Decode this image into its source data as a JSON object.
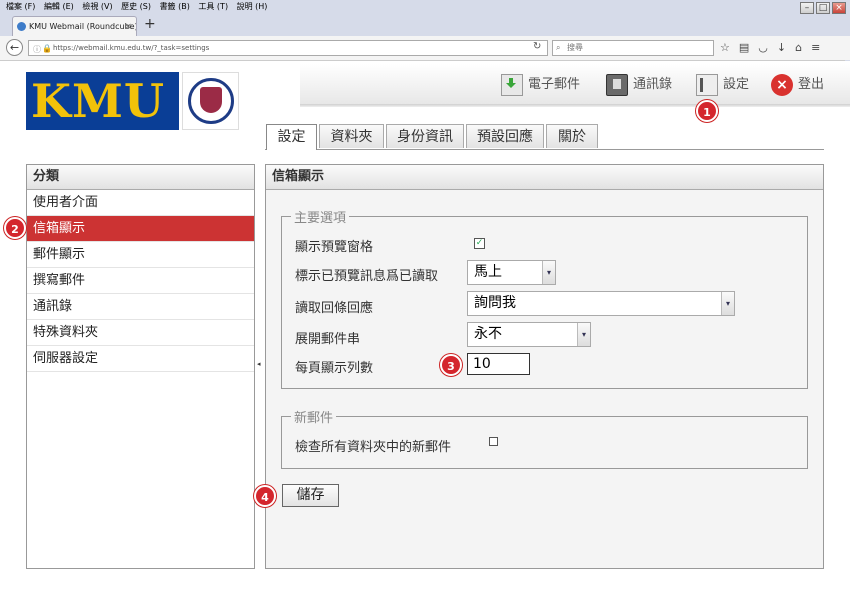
{
  "browser": {
    "menu": [
      "檔案 (F)",
      "編輯 (E)",
      "檢視 (V)",
      "歷史 (S)",
      "書籤 (B)",
      "工具 (T)",
      "說明 (H)"
    ],
    "tab_title": "KMU Webmail (Roundcube) ···",
    "new_tab": "+",
    "url": "https://webmail.kmu.edu.tw/?_task=settings",
    "search_placeholder": "搜尋"
  },
  "logo": {
    "text": "KMU"
  },
  "topnav": {
    "mail": "電子郵件",
    "contacts": "通訊錄",
    "settings": "設定",
    "logout": "登出"
  },
  "tabs": [
    "設定",
    "資料夾",
    "身份資訊",
    "預設回應",
    "關於"
  ],
  "sections": {
    "header": "分類",
    "items": [
      "使用者介面",
      "信箱顯示",
      "郵件顯示",
      "撰寫郵件",
      "通訊錄",
      "特殊資料夾",
      "伺服器設定"
    ],
    "selected": "信箱顯示"
  },
  "prefs": {
    "title": "信箱顯示",
    "main_legend": "主要選項",
    "preview_pane_label": "顯示預覽窗格",
    "preview_pane_checked": true,
    "mark_read_label": "標示已預覽訊息爲已讀取",
    "mark_read_value": "馬上",
    "mdn_label": "讀取回條回應",
    "mdn_value": "詢問我",
    "threads_label": "展開郵件串",
    "threads_value": "永不",
    "rows_label": "每頁顯示列數",
    "rows_value": "10",
    "new_legend": "新郵件",
    "check_all_label": "檢查所有資料夾中的新郵件",
    "check_all_checked": false
  },
  "save_label": "儲存",
  "badges": [
    "1",
    "2",
    "3",
    "4"
  ],
  "colors": {
    "accent": "#cc3333",
    "badge": "#d4262d",
    "logo_bg": "#0a3e96",
    "logo_text": "#f2c20a"
  }
}
